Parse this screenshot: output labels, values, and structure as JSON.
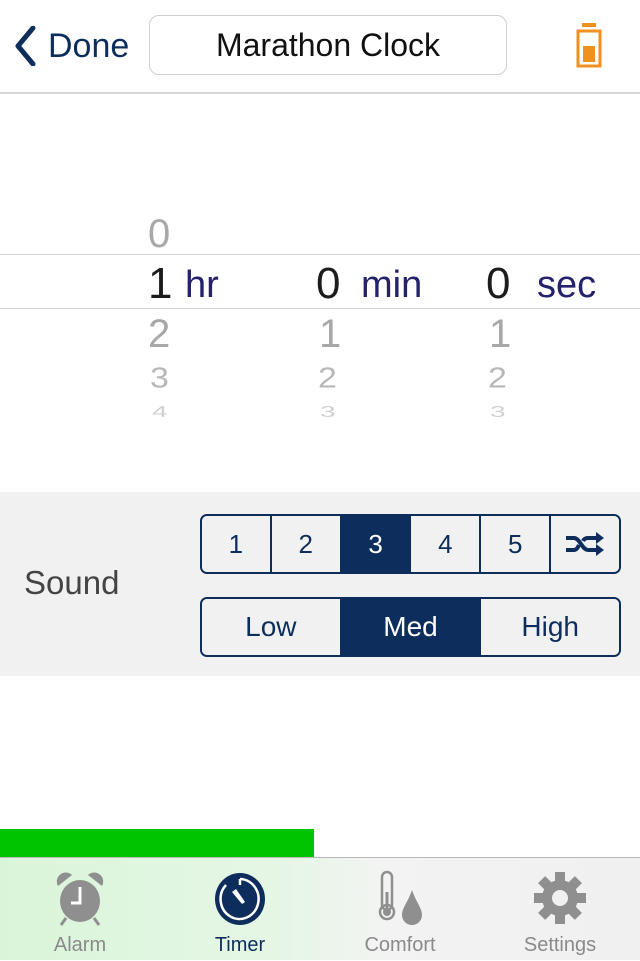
{
  "navbar": {
    "back_label": "Done",
    "title": "Marathon Clock",
    "back_icon": "chevron-left-icon",
    "battery_icon": "battery-low-icon",
    "colors": {
      "accent": "#0d2e5c",
      "battery": "#f0901e"
    }
  },
  "picker": {
    "hours": {
      "above": [
        "0"
      ],
      "selected": "1",
      "below": [
        "2",
        "3",
        "4"
      ],
      "unit": "hr"
    },
    "minutes": {
      "above": [],
      "selected": "0",
      "below": [
        "1",
        "2",
        "3"
      ],
      "unit": "min"
    },
    "seconds": {
      "above": [],
      "selected": "0",
      "below": [
        "1",
        "2",
        "3"
      ],
      "unit": "sec"
    }
  },
  "sound": {
    "label": "Sound",
    "tones": [
      {
        "label": "1",
        "selected": false
      },
      {
        "label": "2",
        "selected": false
      },
      {
        "label": "3",
        "selected": true
      },
      {
        "label": "4",
        "selected": false
      },
      {
        "label": "5",
        "selected": false
      },
      {
        "label": "",
        "icon": "shuffle-icon",
        "selected": false
      }
    ],
    "volume": [
      {
        "label": "Low",
        "selected": false
      },
      {
        "label": "Med",
        "selected": true
      },
      {
        "label": "High",
        "selected": false
      }
    ]
  },
  "progress": {
    "fraction": 0.49,
    "color": "#00c400"
  },
  "tabbar": {
    "tabs": [
      {
        "label": "Alarm",
        "icon": "alarm-clock-icon",
        "active": false
      },
      {
        "label": "Timer",
        "icon": "timer-icon",
        "active": true
      },
      {
        "label": "Comfort",
        "icon": "thermometer-drop-icon",
        "active": false
      },
      {
        "label": "Settings",
        "icon": "gear-icon",
        "active": false
      }
    ]
  }
}
